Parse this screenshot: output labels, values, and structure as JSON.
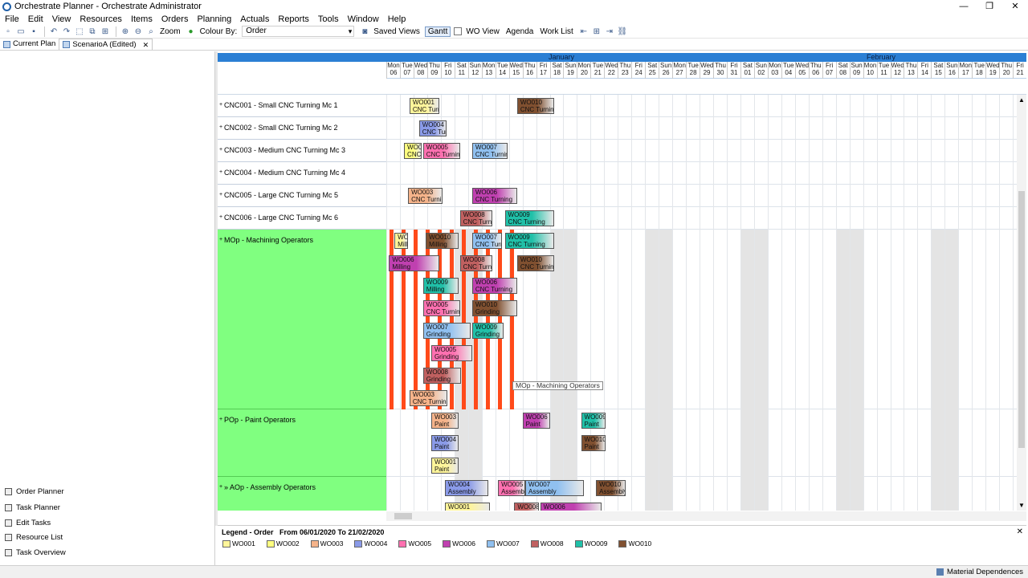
{
  "window": {
    "title": "Orchestrate Planner - Orchestrate Administrator",
    "controls": [
      "—",
      "❐",
      "✕"
    ]
  },
  "menu": [
    "File",
    "Edit",
    "View",
    "Resources",
    "Items",
    "Orders",
    "Planning",
    "Actuals",
    "Reports",
    "Tools",
    "Window",
    "Help"
  ],
  "toolbar": {
    "zoom_label": "Zoom",
    "colour_by_label": "Colour By:",
    "colour_by_value": "Order",
    "saved_views_label": "Saved Views",
    "gantt_label": "Gantt",
    "wo_view_label": "WO View",
    "agenda_label": "Agenda",
    "work_list_label": "Work List"
  },
  "tabs": [
    {
      "label": "Current Plan"
    },
    {
      "label": "ScenarioA (Edited)"
    }
  ],
  "nav": [
    {
      "label": "Order Planner"
    },
    {
      "label": "Task Planner"
    },
    {
      "label": "Edit Tasks"
    },
    {
      "label": "Resource List"
    },
    {
      "label": "Task Overview"
    }
  ],
  "timeline": {
    "months": [
      {
        "label": "January"
      },
      {
        "label": "February"
      }
    ],
    "days": [
      [
        "Mon",
        "06"
      ],
      [
        "Tue",
        "07"
      ],
      [
        "Wed",
        "08"
      ],
      [
        "Thu",
        "09"
      ],
      [
        "Fri",
        "10"
      ],
      [
        "Sat",
        "11"
      ],
      [
        "Sun",
        "12"
      ],
      [
        "Mon",
        "13"
      ],
      [
        "Tue",
        "14"
      ],
      [
        "Wed",
        "15"
      ],
      [
        "Thu",
        "16"
      ],
      [
        "Fri",
        "17"
      ],
      [
        "Sat",
        "18"
      ],
      [
        "Sun",
        "19"
      ],
      [
        "Mon",
        "20"
      ],
      [
        "Tue",
        "21"
      ],
      [
        "Wed",
        "22"
      ],
      [
        "Thu",
        "23"
      ],
      [
        "Fri",
        "24"
      ],
      [
        "Sat",
        "25"
      ],
      [
        "Sun",
        "26"
      ],
      [
        "Mon",
        "27"
      ],
      [
        "Tue",
        "28"
      ],
      [
        "Wed",
        "29"
      ],
      [
        "Thu",
        "30"
      ],
      [
        "Fri",
        "31"
      ],
      [
        "Sat",
        "01"
      ],
      [
        "Sun",
        "02"
      ],
      [
        "Mon",
        "03"
      ],
      [
        "Tue",
        "04"
      ],
      [
        "Wed",
        "05"
      ],
      [
        "Thu",
        "06"
      ],
      [
        "Fri",
        "07"
      ],
      [
        "Sat",
        "08"
      ],
      [
        "Sun",
        "09"
      ],
      [
        "Mon",
        "10"
      ],
      [
        "Tue",
        "11"
      ],
      [
        "Wed",
        "12"
      ],
      [
        "Thu",
        "13"
      ],
      [
        "Fri",
        "14"
      ],
      [
        "Sat",
        "15"
      ],
      [
        "Sun",
        "16"
      ],
      [
        "Mon",
        "17"
      ],
      [
        "Tue",
        "18"
      ],
      [
        "Wed",
        "19"
      ],
      [
        "Thu",
        "20"
      ],
      [
        "Fri",
        "21"
      ]
    ]
  },
  "resources": [
    {
      "label": "CNC001 - Small CNC Turning Mc 1",
      "group": false
    },
    {
      "label": "CNC002 - Small CNC Turning Mc 2",
      "group": false
    },
    {
      "label": "CNC003 - Medium CNC Turning Mc 3",
      "group": false
    },
    {
      "label": "CNC004 - Medium CNC Turning Mc 4",
      "group": false
    },
    {
      "label": "CNC005 - Large CNC Turning Mc 5",
      "group": false
    },
    {
      "label": "CNC006 - Large CNC Turning Mc 6",
      "group": false
    },
    {
      "label": "MOp - Machining Operators",
      "group": true
    },
    {
      "label": "POp - Paint Operators",
      "group": true
    },
    {
      "label": "» AOp - Assembly Operators",
      "group": true
    }
  ],
  "orders": {
    "WO001": "#fff59a",
    "WO002": "#ffff80",
    "WO003": "#f5b38a",
    "WO004": "#8a9ae8",
    "WO005": "#ff70b0",
    "WO006": "#c040b0",
    "WO007": "#90c0f0",
    "WO008": "#c06060",
    "WO009": "#20c0a8",
    "WO010": "#805030"
  },
  "tasks": [
    {
      "row": 0,
      "order": "WO001",
      "op": "CNC Turning",
      "label": "WO001",
      "start": 1.7,
      "len": 2.2
    },
    {
      "row": 0,
      "order": "WO010",
      "op": "CNC Turning",
      "label": "WO010",
      "start": 9.6,
      "len": 2.7
    },
    {
      "row": 1,
      "order": "WO004",
      "op": "CNC Turning",
      "label": "WO004",
      "start": 2.4,
      "len": 2.0
    },
    {
      "row": 2,
      "order": "WO002",
      "op": "CNC",
      "label": "WO0",
      "start": 1.3,
      "len": 1.3
    },
    {
      "row": 2,
      "order": "WO005",
      "op": "CNC Turning",
      "label": "WO005",
      "start": 2.7,
      "len": 2.7
    },
    {
      "row": 2,
      "order": "WO007",
      "op": "CNC Turning",
      "label": "WO007",
      "start": 6.3,
      "len": 2.6
    },
    {
      "row": 4,
      "order": "WO003",
      "op": "CNC Turning",
      "label": "WO003",
      "start": 1.6,
      "len": 2.5
    },
    {
      "row": 4,
      "order": "WO006",
      "op": "CNC Turning",
      "label": "WO006",
      "start": 6.3,
      "len": 3.3
    },
    {
      "row": 5,
      "order": "WO008",
      "op": "CNC Turning",
      "label": "WO008",
      "start": 5.4,
      "len": 2.4
    },
    {
      "row": 5,
      "order": "WO009",
      "op": "CNC Turning",
      "label": "WO009",
      "start": 8.7,
      "len": 3.6
    },
    {
      "row": 6,
      "sub": 0,
      "order": "WO001",
      "op": "Milli",
      "label": "WO0",
      "start": 0.6,
      "len": 1.0
    },
    {
      "row": 6,
      "sub": 0,
      "order": "WO010",
      "op": "Milling",
      "label": "WO010",
      "start": 2.9,
      "len": 2.4
    },
    {
      "row": 6,
      "sub": 0,
      "order": "WO007",
      "op": "CNC Turn",
      "label": "WO007",
      "start": 6.3,
      "len": 2.2
    },
    {
      "row": 6,
      "sub": 0,
      "order": "WO009",
      "op": "CNC Turning",
      "label": "WO009",
      "start": 8.7,
      "len": 3.6
    },
    {
      "row": 6,
      "sub": 1,
      "order": "WO006",
      "op": "Milling",
      "label": "WO006",
      "start": 0.2,
      "len": 3.7
    },
    {
      "row": 6,
      "sub": 1,
      "order": "WO008",
      "op": "CNC Turning",
      "label": "WO008",
      "start": 5.4,
      "len": 2.4
    },
    {
      "row": 6,
      "sub": 1,
      "order": "WO010",
      "op": "CNC Turning",
      "label": "WO010",
      "start": 9.6,
      "len": 2.7
    },
    {
      "row": 6,
      "sub": 2,
      "order": "WO009",
      "op": "Milling",
      "label": "WO009",
      "start": 2.7,
      "len": 2.6
    },
    {
      "row": 6,
      "sub": 2,
      "order": "WO006",
      "op": "CNC Turning",
      "label": "WO006",
      "start": 6.3,
      "len": 3.3
    },
    {
      "row": 6,
      "sub": 3,
      "order": "WO005",
      "op": "CNC Turning",
      "label": "WO005",
      "start": 2.7,
      "len": 2.7
    },
    {
      "row": 6,
      "sub": 3,
      "order": "WO010",
      "op": "Grinding",
      "label": "WO010",
      "start": 6.3,
      "len": 3.3
    },
    {
      "row": 6,
      "sub": 4,
      "order": "WO007",
      "op": "Grinding",
      "label": "WO007",
      "start": 2.7,
      "len": 3.5
    },
    {
      "row": 6,
      "sub": 4,
      "order": "WO009",
      "op": "Grinding",
      "label": "WO009",
      "start": 6.3,
      "len": 2.3
    },
    {
      "row": 6,
      "sub": 5,
      "order": "WO005",
      "op": "Grinding",
      "label": "WO005",
      "start": 3.3,
      "len": 3.0
    },
    {
      "row": 6,
      "sub": 6,
      "order": "WO008",
      "op": "Grinding",
      "label": "WO008",
      "start": 2.7,
      "len": 2.8
    },
    {
      "row": 6,
      "sub": 7,
      "order": "WO003",
      "op": "CNC Turning",
      "label": "WO003",
      "start": 1.7,
      "len": 2.8
    },
    {
      "row": 7,
      "sub": 0,
      "order": "WO003",
      "op": "Paint",
      "label": "WO003",
      "start": 3.3,
      "len": 2.0
    },
    {
      "row": 7,
      "sub": 0,
      "order": "WO006",
      "op": "Paint",
      "label": "WO006",
      "start": 10.0,
      "len": 2.0
    },
    {
      "row": 7,
      "sub": 0,
      "order": "WO009",
      "op": "Paint",
      "label": "WO009",
      "start": 14.3,
      "len": 1.8
    },
    {
      "row": 7,
      "sub": 1,
      "order": "WO004",
      "op": "Paint",
      "label": "WO004",
      "start": 3.3,
      "len": 2.0
    },
    {
      "row": 7,
      "sub": 1,
      "order": "WO010",
      "op": "Paint",
      "label": "WO010",
      "start": 14.3,
      "len": 1.8
    },
    {
      "row": 7,
      "sub": 2,
      "order": "WO001",
      "op": "Paint",
      "label": "WO001",
      "start": 3.3,
      "len": 2.0
    },
    {
      "row": 8,
      "sub": 0,
      "order": "WO004",
      "op": "Assembly",
      "label": "WO004",
      "start": 4.3,
      "len": 3.2
    },
    {
      "row": 8,
      "sub": 0,
      "order": "WO005",
      "op": "Assemb",
      "label": "WO005",
      "start": 8.2,
      "len": 2.0
    },
    {
      "row": 8,
      "sub": 0,
      "order": "WO007",
      "op": "Assembly",
      "label": "WO007",
      "start": 10.2,
      "len": 4.3
    },
    {
      "row": 8,
      "sub": 0,
      "order": "WO010",
      "op": "Assembly",
      "label": "WO010",
      "start": 15.4,
      "len": 2.2
    },
    {
      "row": 8,
      "sub": 1,
      "order": "WO001",
      "op": "",
      "label": "WO001",
      "start": 4.3,
      "len": 3.3
    },
    {
      "row": 8,
      "sub": 1,
      "order": "WO008",
      "op": "",
      "label": "WO008",
      "start": 9.4,
      "len": 1.8
    },
    {
      "row": 8,
      "sub": 1,
      "order": "WO006",
      "op": "",
      "label": "WO006",
      "start": 11.3,
      "len": 4.5
    }
  ],
  "tooltip": "MOp - Machining Operators",
  "legend": {
    "title": "Legend - Order",
    "range": "From 06/01/2020 To 21/02/2020",
    "items": [
      "WO001",
      "WO002",
      "WO003",
      "WO004",
      "WO005",
      "WO006",
      "WO007",
      "WO008",
      "WO009",
      "WO010"
    ]
  },
  "status": {
    "material_dependences": "Material Dependences"
  }
}
